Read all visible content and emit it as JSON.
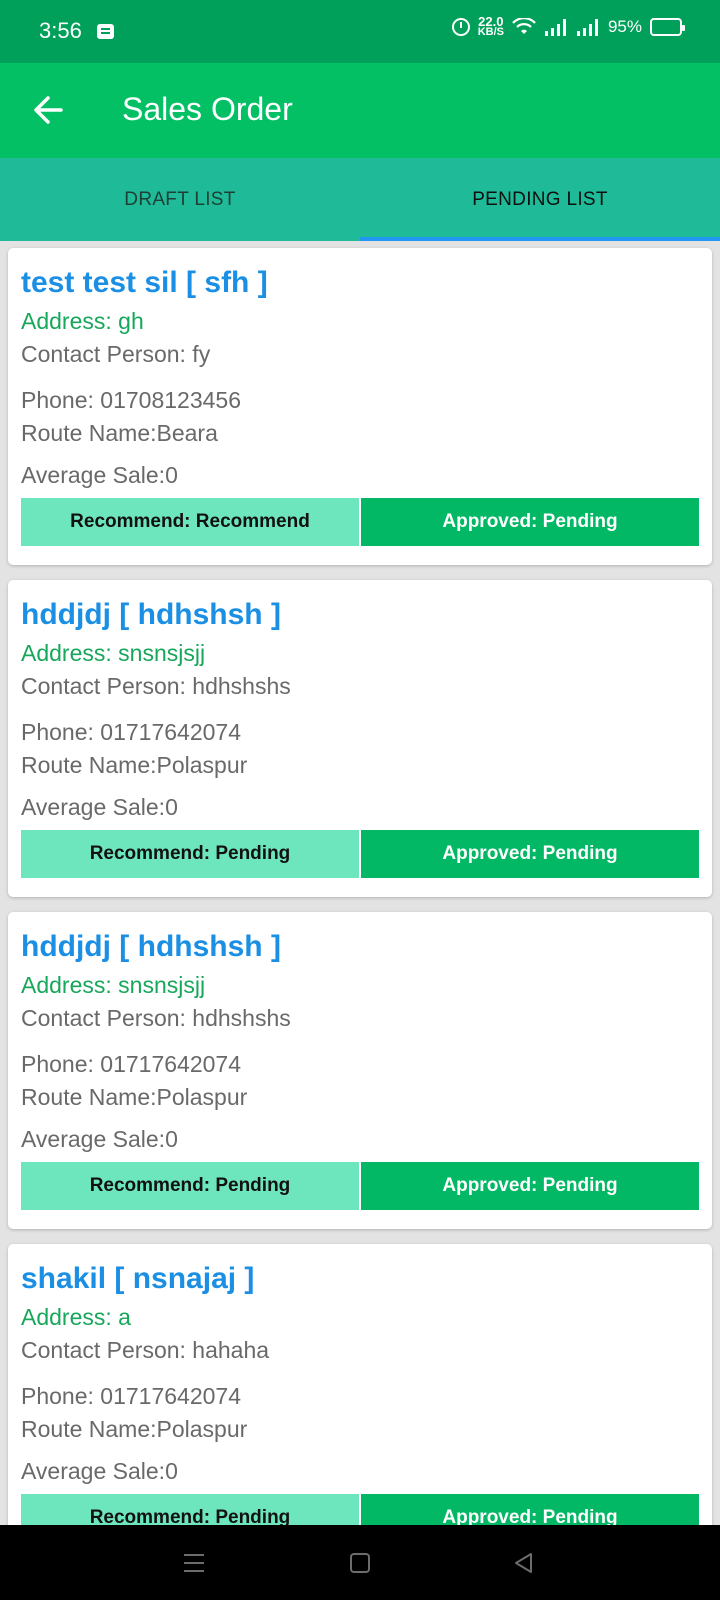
{
  "status": {
    "time": "3:56",
    "speed_value": "22.0",
    "speed_unit": "KB/S",
    "battery": "95%"
  },
  "header": {
    "title": "Sales Order"
  },
  "tabs": [
    {
      "label": "DRAFT LIST"
    },
    {
      "label": "PENDING LIST"
    }
  ],
  "orders": [
    {
      "title": "test test sil [ sfh ]",
      "address": "Address: gh",
      "contact": "Contact Person: fy",
      "phone": "Phone: 01708123456",
      "route": "Route Name:Beara",
      "avg_sale": "Average Sale:0",
      "recommend": "Recommend: Recommend",
      "approved": "Approved: Pending"
    },
    {
      "title": "hddjdj [ hdhshsh ]",
      "address": "Address: snsnsjsjj",
      "contact": "Contact Person: hdhshshs",
      "phone": "Phone: 01717642074",
      "route": "Route Name:Polaspur",
      "avg_sale": "Average Sale:0",
      "recommend": "Recommend: Pending",
      "approved": "Approved: Pending"
    },
    {
      "title": "hddjdj [ hdhshsh ]",
      "address": "Address: snsnsjsjj",
      "contact": "Contact Person: hdhshshs",
      "phone": "Phone: 01717642074",
      "route": "Route Name:Polaspur",
      "avg_sale": "Average Sale:0",
      "recommend": "Recommend: Pending",
      "approved": "Approved: Pending"
    },
    {
      "title": "shakil [ nsnajaj ]",
      "address": "Address: a",
      "contact": "Contact Person: hahaha",
      "phone": "Phone: 01717642074",
      "route": "Route Name:Polaspur",
      "avg_sale": "Average Sale:0",
      "recommend": "Recommend: Pending",
      "approved": "Approved: Pending"
    }
  ]
}
